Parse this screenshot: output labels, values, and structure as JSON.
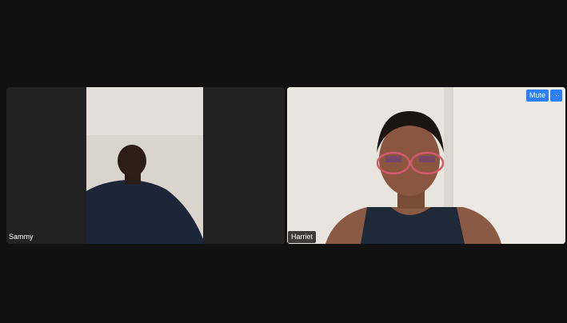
{
  "meeting": {
    "participants": [
      {
        "name": "Sammy"
      },
      {
        "name": "Harriet"
      }
    ],
    "tile_controls": {
      "mute_label": "Mute",
      "more_label": "···"
    }
  },
  "colors": {
    "background": "#111111",
    "tile_background": "#222222",
    "accent_button": "#2d7ff9"
  }
}
